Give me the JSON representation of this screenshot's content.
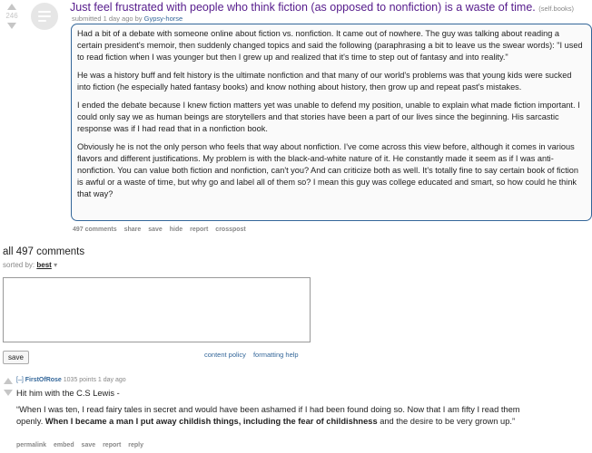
{
  "post": {
    "score": "246",
    "title": "Just feel frustrated with people who think fiction (as opposed to nonfiction) is a waste of time.",
    "domain": "(self.books)",
    "submitted_prefix": "submitted 1 day ago by",
    "author": "Gypsy-horse",
    "paragraphs": [
      "Had a bit of a debate with someone online about fiction vs. nonfiction. It came out of nowhere. The guy was talking about reading a certain president's memoir, then suddenly changed topics and said the following (paraphrasing a bit to leave us the swear words): \"I used to read fiction when I was younger but then I grew up and realized that it's time to step out of fantasy and into reality.\"",
      "He was a history buff and felt history is the ultimate nonfiction and that many of our world's problems was that young kids were sucked into fiction (he especially hated fantasy books) and know nothing about history, then grow up and repeat past's mistakes.",
      "I ended the debate because I knew fiction matters yet was unable to defend my position, unable to explain what made fiction important. I could only say we as human beings are storytellers and that stories have been a part of our lives since the beginning. His sarcastic response was if I had read that in a nonfiction book.",
      "Obviously he is not the only person who feels that way about nonfiction. I've come across this view before, although it comes in various flavors and different justifications. My problem is with the black-and-white nature of it. He constantly made it seem as if I was anti-nonfiction. You can value both fiction and nonfiction, can't you? And can criticize both as well. It's totally fine to say certain book of fiction is awful or a waste of time, but why go and label all of them so? I mean this guy was college educated and smart, so how could he think that way?"
    ],
    "buttons": [
      "497 comments",
      "share",
      "save",
      "hide",
      "report",
      "crosspost"
    ]
  },
  "comments_section": {
    "count_label": "all 497 comments",
    "sorted_by_label": "sorted by:",
    "sort_value": "best",
    "save_label": "save",
    "content_policy": "content policy",
    "formatting_help": "formatting help"
  },
  "comment": {
    "expand": "[–]",
    "author": "FirstOfRose",
    "meta": "1035 points 1 day ago",
    "line1": "Hit him with the C.S Lewis -",
    "quote_plain": "“When I was ten, I read fairy tales in secret and would have been ashamed if I had been found doing so. Now that I am fifty I read them openly. ",
    "quote_bold": "When I became a man I put away childish things, including the fear of childishness",
    "quote_end": " and the desire to be very grown up.”",
    "buttons": [
      "permalink",
      "embed",
      "save",
      "report",
      "reply"
    ]
  },
  "colors": {
    "link": "#336699",
    "visited_title": "#551a8b",
    "muted": "#888888",
    "vote_arrow": "#c6c6c6"
  }
}
